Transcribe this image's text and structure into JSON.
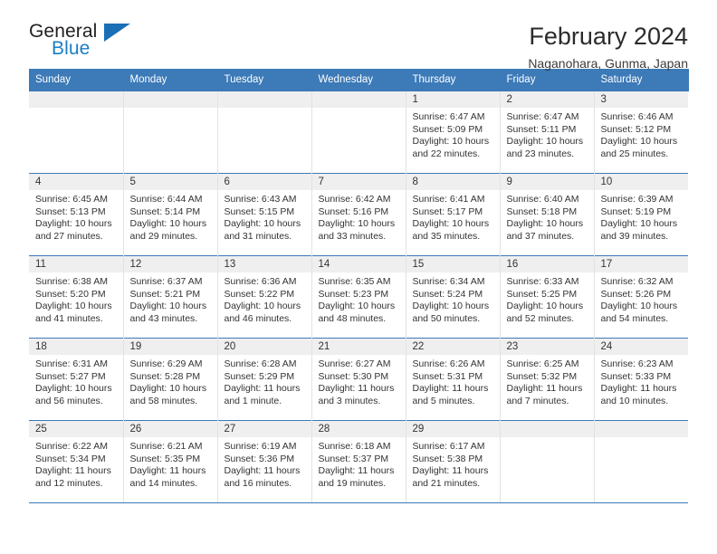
{
  "brand": {
    "name_top": "General",
    "name_bottom": "Blue",
    "triangle_icon": "brand-triangle-icon",
    "color_dark": "#231f20",
    "color_blue": "#1b7fc4"
  },
  "header": {
    "title": "February 2024",
    "subtitle": "Naganohara, Gunma, Japan"
  },
  "theme": {
    "header_blue": "#3c7ab8",
    "daynum_band": "#efefef",
    "text": "#333333",
    "grid_line": "#e2e2e2"
  },
  "calendar": {
    "weekday_headers": [
      "Sunday",
      "Monday",
      "Tuesday",
      "Wednesday",
      "Thursday",
      "Friday",
      "Saturday"
    ],
    "labels": {
      "sunrise": "Sunrise:",
      "sunset": "Sunset:",
      "daylight": "Daylight:"
    },
    "weeks": [
      [
        {
          "day": "",
          "empty": true
        },
        {
          "day": "",
          "empty": true
        },
        {
          "day": "",
          "empty": true
        },
        {
          "day": "",
          "empty": true
        },
        {
          "day": "1",
          "sunrise": "Sunrise: 6:47 AM",
          "sunset": "Sunset: 5:09 PM",
          "daylight_1": "Daylight: 10 hours",
          "daylight_2": "and 22 minutes."
        },
        {
          "day": "2",
          "sunrise": "Sunrise: 6:47 AM",
          "sunset": "Sunset: 5:11 PM",
          "daylight_1": "Daylight: 10 hours",
          "daylight_2": "and 23 minutes."
        },
        {
          "day": "3",
          "sunrise": "Sunrise: 6:46 AM",
          "sunset": "Sunset: 5:12 PM",
          "daylight_1": "Daylight: 10 hours",
          "daylight_2": "and 25 minutes."
        }
      ],
      [
        {
          "day": "4",
          "sunrise": "Sunrise: 6:45 AM",
          "sunset": "Sunset: 5:13 PM",
          "daylight_1": "Daylight: 10 hours",
          "daylight_2": "and 27 minutes."
        },
        {
          "day": "5",
          "sunrise": "Sunrise: 6:44 AM",
          "sunset": "Sunset: 5:14 PM",
          "daylight_1": "Daylight: 10 hours",
          "daylight_2": "and 29 minutes."
        },
        {
          "day": "6",
          "sunrise": "Sunrise: 6:43 AM",
          "sunset": "Sunset: 5:15 PM",
          "daylight_1": "Daylight: 10 hours",
          "daylight_2": "and 31 minutes."
        },
        {
          "day": "7",
          "sunrise": "Sunrise: 6:42 AM",
          "sunset": "Sunset: 5:16 PM",
          "daylight_1": "Daylight: 10 hours",
          "daylight_2": "and 33 minutes."
        },
        {
          "day": "8",
          "sunrise": "Sunrise: 6:41 AM",
          "sunset": "Sunset: 5:17 PM",
          "daylight_1": "Daylight: 10 hours",
          "daylight_2": "and 35 minutes."
        },
        {
          "day": "9",
          "sunrise": "Sunrise: 6:40 AM",
          "sunset": "Sunset: 5:18 PM",
          "daylight_1": "Daylight: 10 hours",
          "daylight_2": "and 37 minutes."
        },
        {
          "day": "10",
          "sunrise": "Sunrise: 6:39 AM",
          "sunset": "Sunset: 5:19 PM",
          "daylight_1": "Daylight: 10 hours",
          "daylight_2": "and 39 minutes."
        }
      ],
      [
        {
          "day": "11",
          "sunrise": "Sunrise: 6:38 AM",
          "sunset": "Sunset: 5:20 PM",
          "daylight_1": "Daylight: 10 hours",
          "daylight_2": "and 41 minutes."
        },
        {
          "day": "12",
          "sunrise": "Sunrise: 6:37 AM",
          "sunset": "Sunset: 5:21 PM",
          "daylight_1": "Daylight: 10 hours",
          "daylight_2": "and 43 minutes."
        },
        {
          "day": "13",
          "sunrise": "Sunrise: 6:36 AM",
          "sunset": "Sunset: 5:22 PM",
          "daylight_1": "Daylight: 10 hours",
          "daylight_2": "and 46 minutes."
        },
        {
          "day": "14",
          "sunrise": "Sunrise: 6:35 AM",
          "sunset": "Sunset: 5:23 PM",
          "daylight_1": "Daylight: 10 hours",
          "daylight_2": "and 48 minutes."
        },
        {
          "day": "15",
          "sunrise": "Sunrise: 6:34 AM",
          "sunset": "Sunset: 5:24 PM",
          "daylight_1": "Daylight: 10 hours",
          "daylight_2": "and 50 minutes."
        },
        {
          "day": "16",
          "sunrise": "Sunrise: 6:33 AM",
          "sunset": "Sunset: 5:25 PM",
          "daylight_1": "Daylight: 10 hours",
          "daylight_2": "and 52 minutes."
        },
        {
          "day": "17",
          "sunrise": "Sunrise: 6:32 AM",
          "sunset": "Sunset: 5:26 PM",
          "daylight_1": "Daylight: 10 hours",
          "daylight_2": "and 54 minutes."
        }
      ],
      [
        {
          "day": "18",
          "sunrise": "Sunrise: 6:31 AM",
          "sunset": "Sunset: 5:27 PM",
          "daylight_1": "Daylight: 10 hours",
          "daylight_2": "and 56 minutes."
        },
        {
          "day": "19",
          "sunrise": "Sunrise: 6:29 AM",
          "sunset": "Sunset: 5:28 PM",
          "daylight_1": "Daylight: 10 hours",
          "daylight_2": "and 58 minutes."
        },
        {
          "day": "20",
          "sunrise": "Sunrise: 6:28 AM",
          "sunset": "Sunset: 5:29 PM",
          "daylight_1": "Daylight: 11 hours",
          "daylight_2": "and 1 minute."
        },
        {
          "day": "21",
          "sunrise": "Sunrise: 6:27 AM",
          "sunset": "Sunset: 5:30 PM",
          "daylight_1": "Daylight: 11 hours",
          "daylight_2": "and 3 minutes."
        },
        {
          "day": "22",
          "sunrise": "Sunrise: 6:26 AM",
          "sunset": "Sunset: 5:31 PM",
          "daylight_1": "Daylight: 11 hours",
          "daylight_2": "and 5 minutes."
        },
        {
          "day": "23",
          "sunrise": "Sunrise: 6:25 AM",
          "sunset": "Sunset: 5:32 PM",
          "daylight_1": "Daylight: 11 hours",
          "daylight_2": "and 7 minutes."
        },
        {
          "day": "24",
          "sunrise": "Sunrise: 6:23 AM",
          "sunset": "Sunset: 5:33 PM",
          "daylight_1": "Daylight: 11 hours",
          "daylight_2": "and 10 minutes."
        }
      ],
      [
        {
          "day": "25",
          "sunrise": "Sunrise: 6:22 AM",
          "sunset": "Sunset: 5:34 PM",
          "daylight_1": "Daylight: 11 hours",
          "daylight_2": "and 12 minutes."
        },
        {
          "day": "26",
          "sunrise": "Sunrise: 6:21 AM",
          "sunset": "Sunset: 5:35 PM",
          "daylight_1": "Daylight: 11 hours",
          "daylight_2": "and 14 minutes."
        },
        {
          "day": "27",
          "sunrise": "Sunrise: 6:19 AM",
          "sunset": "Sunset: 5:36 PM",
          "daylight_1": "Daylight: 11 hours",
          "daylight_2": "and 16 minutes."
        },
        {
          "day": "28",
          "sunrise": "Sunrise: 6:18 AM",
          "sunset": "Sunset: 5:37 PM",
          "daylight_1": "Daylight: 11 hours",
          "daylight_2": "and 19 minutes."
        },
        {
          "day": "29",
          "sunrise": "Sunrise: 6:17 AM",
          "sunset": "Sunset: 5:38 PM",
          "daylight_1": "Daylight: 11 hours",
          "daylight_2": "and 21 minutes."
        },
        {
          "day": "",
          "empty": true
        },
        {
          "day": "",
          "empty": true
        }
      ]
    ]
  }
}
